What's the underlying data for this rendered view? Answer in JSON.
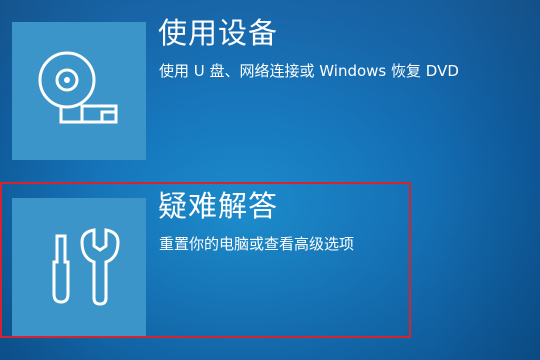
{
  "options": [
    {
      "title": "使用设备",
      "description": "使用 U 盘、网络连接或 Windows 恢复 DVD",
      "icon": "disc-drive-icon"
    },
    {
      "title": "疑难解答",
      "description": "重置你的电脑或查看高级选项",
      "icon": "tools-icon",
      "highlighted": true
    }
  ],
  "colors": {
    "background": "#1677bd",
    "tile": "#3c95c8",
    "highlight_border": "#d6242f",
    "text": "#ffffff"
  }
}
